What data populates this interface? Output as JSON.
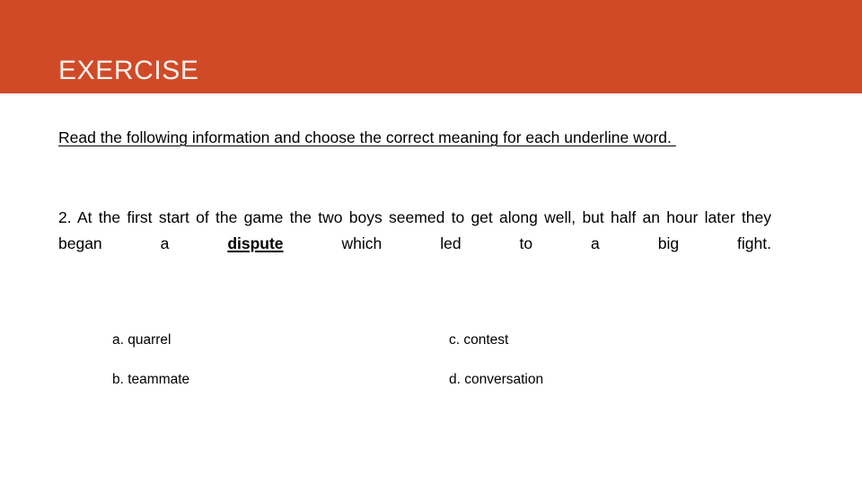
{
  "slide": {
    "title": "EXERCISE",
    "header_color": "#d04a28",
    "title_color": "#fdf3ee",
    "background_color": "#ffffff",
    "text_color": "#000000"
  },
  "instruction": {
    "text": "Read the following information and choose the correct meaning for each underline word."
  },
  "question": {
    "number": "2.",
    "before_keyword": "At  the first start of the game the two boys seemed to get along well, but half an hour later they began a ",
    "keyword": "dispute",
    "after_keyword": " which led to a big fight."
  },
  "options": {
    "rows": [
      {
        "left": "a. quarrel",
        "right": "c. contest"
      },
      {
        "left": "b. teammate",
        "right": "d. conversation"
      }
    ]
  }
}
